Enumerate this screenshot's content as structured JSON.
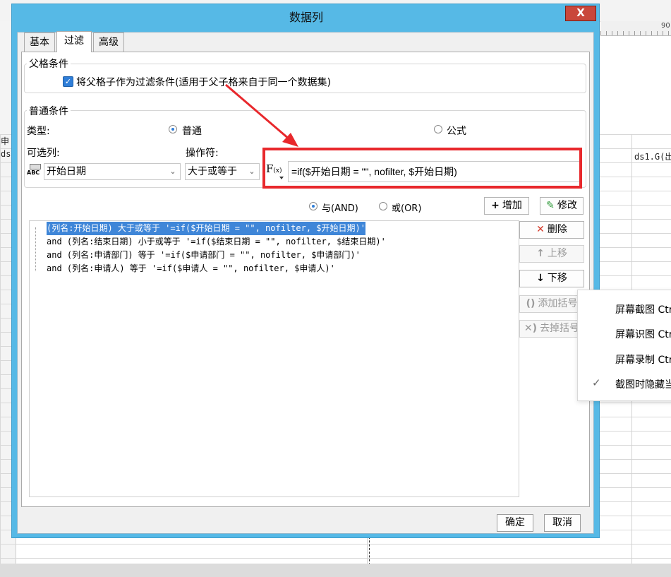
{
  "background": {
    "ruler_number": "90",
    "cell_left_top": "申",
    "cell_left_bottom": "ds1",
    "cell_right": "ds1.G(出"
  },
  "dialog": {
    "title": "数据列",
    "close_label": "X",
    "tabs": [
      "基本",
      "过滤",
      "高级"
    ],
    "active_tab": "过滤"
  },
  "parent": {
    "section_label": "父格条件",
    "checkbox_label": "将父格子作为过滤条件(适用于父子格来自于同一个数据集)",
    "checked": true
  },
  "normal": {
    "section_label": "普通条件",
    "type_label": "类型:",
    "type_options": [
      "普通",
      "公式"
    ],
    "type_selected": "普通",
    "column_label": "可选列:",
    "column_value": "开始日期",
    "column_icon": "abc-field-icon",
    "operator_label": "操作符:",
    "operator_value": "大于或等于",
    "formula_icon": "fx-formula-icon",
    "formula_icon_text": "F",
    "formula_icon_sub": "(x)",
    "formula_value": "=if($开始日期 = \"\", nofilter, $开始日期)",
    "logic_options": [
      "与(AND)",
      "或(OR)"
    ],
    "logic_selected": "与(AND)",
    "add_button": "增加",
    "modify_button": "修改"
  },
  "conditions": [
    "(列名:开始日期) 大于或等于 '=if($开始日期 = \"\", nofilter, $开始日期)'",
    "and (列名:结束日期) 小于或等于 '=if($结束日期 = \"\", nofilter, $结束日期)'",
    "and (列名:申请部门) 等于 '=if($申请部门 = \"\", nofilter, $申请部门)'",
    "and (列名:申请人) 等于 '=if($申请人 = \"\", nofilter, $申请人)'"
  ],
  "selected_condition_index": 0,
  "side_buttons": {
    "delete": "删除",
    "move_up": "上移",
    "move_down": "下移",
    "add_bracket": "添加括号",
    "remove_bracket": "去掉括号"
  },
  "footer": {
    "ok": "确定",
    "cancel": "取消"
  },
  "context_menu": {
    "items": [
      "屏幕截图 Ctrl",
      "屏幕识图 Ctrl",
      "屏幕录制 Ctrl",
      "截图时隐藏当前窗口"
    ],
    "checked_index": 3
  },
  "colors": {
    "dialog_frame": "#56b9e6",
    "close_button": "#c9473b",
    "highlight_box": "#e8282c",
    "selection": "#3f86d8"
  }
}
